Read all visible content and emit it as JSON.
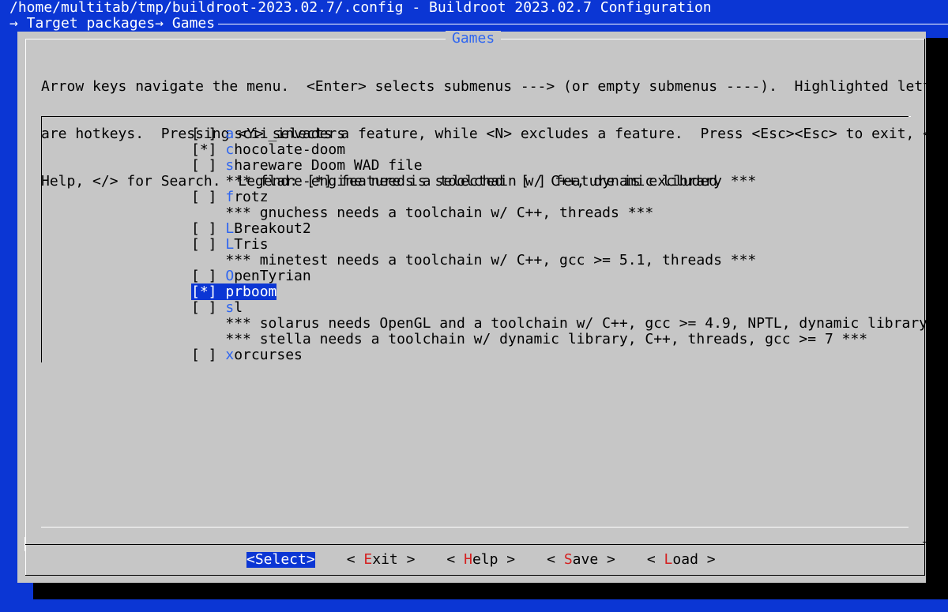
{
  "window": {
    "title": "/home/multitab/tmp/buildroot-2023.02.7/.config - Buildroot 2023.02.7 Configuration",
    "breadcrumb": "→ Target packages→ Games"
  },
  "dialog": {
    "title": "Games",
    "help_lines": [
      "Arrow keys navigate the menu.  <Enter> selects submenus ---> (or empty submenus ----).  Highlighted letters",
      "are hotkeys.  Pressing <Y> selects a feature, while <N> excludes a feature.  Press <Esc><Esc> to exit, <?> for",
      "Help, </> for Search.  Legend: [*] feature is selected  [ ] feature is excluded"
    ]
  },
  "menu": {
    "items": [
      {
        "mark": "[ ] ",
        "hotkey": "a",
        "rest": "scii_invaders"
      },
      {
        "mark": "[*] ",
        "hotkey": "c",
        "rest": "hocolate-doom"
      },
      {
        "mark": "[ ] ",
        "hotkey": "s",
        "rest": "hareware Doom WAD file"
      },
      {
        "mark": "    ",
        "hotkey": "",
        "rest": "*** flare-engine needs a toolchain w/ C++, dynamic library ***"
      },
      {
        "mark": "[ ] ",
        "hotkey": "f",
        "rest": "rotz"
      },
      {
        "mark": "    ",
        "hotkey": "",
        "rest": "*** gnuchess needs a toolchain w/ C++, threads ***"
      },
      {
        "mark": "[ ] ",
        "hotkey": "L",
        "rest": "Breakout2"
      },
      {
        "mark": "[ ] ",
        "hotkey": "L",
        "rest": "Tris"
      },
      {
        "mark": "    ",
        "hotkey": "",
        "rest": "*** minetest needs a toolchain w/ C++, gcc >= 5.1, threads ***"
      },
      {
        "mark": "[ ] ",
        "hotkey": "O",
        "rest": "penTyrian"
      },
      {
        "mark": "[*] ",
        "hotkey": "p",
        "rest": "rboom"
      },
      {
        "mark": "[ ] ",
        "hotkey": "s",
        "rest": "l"
      },
      {
        "mark": "    ",
        "hotkey": "",
        "rest": "*** solarus needs OpenGL and a toolchain w/ C++, gcc >= 4.9, NPTL, dynamic library, an"
      },
      {
        "mark": "    ",
        "hotkey": "",
        "rest": "*** stella needs a toolchain w/ dynamic library, C++, threads, gcc >= 7 ***"
      },
      {
        "mark": "[ ] ",
        "hotkey": "x",
        "rest": "orcurses"
      }
    ],
    "selected_item": "prboom"
  },
  "buttons": {
    "select": "<Select>",
    "exit": {
      "pre": "< ",
      "hot": "E",
      "post": "xit >"
    },
    "help": {
      "pre": "< ",
      "hot": "H",
      "post": "elp >"
    },
    "save": {
      "pre": "< ",
      "hot": "S",
      "post": "ave >"
    },
    "load": {
      "pre": "< ",
      "hot": "L",
      "post": "oad >"
    }
  },
  "colors": {
    "background": "#0b36d4",
    "dialog": "#c6c6c6",
    "hotkey": "#2f66f0",
    "button_hotkey": "#d42020",
    "selection": "#0b36d4"
  }
}
